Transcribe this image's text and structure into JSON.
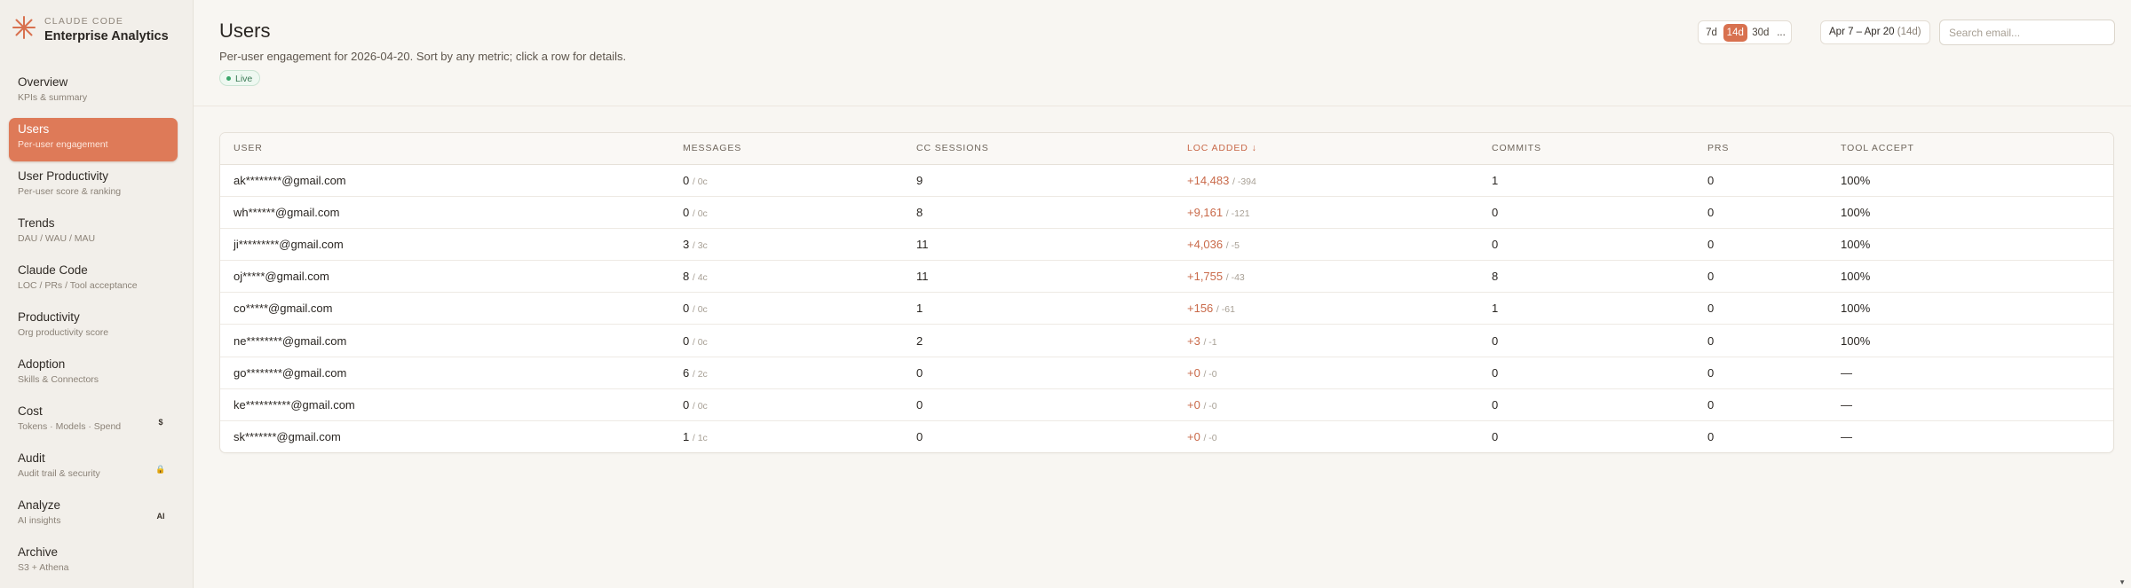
{
  "brand": {
    "sub": "CLAUDE CODE",
    "title": "Enterprise Analytics",
    "mark": "sparkle-icon"
  },
  "nav": [
    {
      "label": "Overview",
      "sub": "KPIs & summary"
    },
    {
      "label": "Users",
      "sub": "Per-user engagement",
      "active": true
    },
    {
      "label": "User Productivity",
      "sub": "Per-user score & ranking"
    },
    {
      "label": "Trends",
      "sub": "DAU / WAU / MAU"
    },
    {
      "label": "Claude Code",
      "sub": "LOC / PRs / Tool acceptance"
    },
    {
      "label": "Productivity",
      "sub": "Org productivity score"
    },
    {
      "label": "Adoption",
      "sub": "Skills & Connectors"
    },
    {
      "label": "Cost",
      "sub": "Tokens · Models · Spend",
      "badge": "$"
    },
    {
      "label": "Audit",
      "sub": "Audit trail & security",
      "badge": "🔒"
    },
    {
      "label": "Analyze",
      "sub": "AI insights",
      "badge": "AI"
    },
    {
      "label": "Archive",
      "sub": "S3 + Athena"
    }
  ],
  "header": {
    "title": "Users",
    "description": "Per-user engagement for 2026-04-20. Sort by any metric; click a row for details.",
    "live": "Live",
    "periods": [
      "7d",
      "14d",
      "30d",
      "..."
    ],
    "active_period": "14d",
    "range": "Apr 7 – Apr 20",
    "range_days": "(14d)",
    "search_placeholder": "Search email..."
  },
  "table": {
    "columns": [
      "USER",
      "MESSAGES",
      "CC SESSIONS",
      "LOC ADDED ↓",
      "COMMITS",
      "PRS",
      "TOOL ACCEPT"
    ],
    "sorted_column": 3,
    "rows": [
      {
        "user": "ak********@gmail.com",
        "msgs": "0",
        "msgs_sub": "/ 0c",
        "sessions": "9",
        "loc": "+14,483",
        "loc_sub": "/ -394",
        "commits": "1",
        "prs": "0",
        "accept": "100%"
      },
      {
        "user": "wh******@gmail.com",
        "msgs": "0",
        "msgs_sub": "/ 0c",
        "sessions": "8",
        "loc": "+9,161",
        "loc_sub": "/ -121",
        "commits": "0",
        "prs": "0",
        "accept": "100%"
      },
      {
        "user": "ji*********@gmail.com",
        "msgs": "3",
        "msgs_sub": "/ 3c",
        "sessions": "11",
        "loc": "+4,036",
        "loc_sub": "/ -5",
        "commits": "0",
        "prs": "0",
        "accept": "100%"
      },
      {
        "user": "oj*****@gmail.com",
        "msgs": "8",
        "msgs_sub": "/ 4c",
        "sessions": "11",
        "loc": "+1,755",
        "loc_sub": "/ -43",
        "commits": "8",
        "prs": "0",
        "accept": "100%"
      },
      {
        "user": "co*****@gmail.com",
        "msgs": "0",
        "msgs_sub": "/ 0c",
        "sessions": "1",
        "loc": "+156",
        "loc_sub": "/ -61",
        "commits": "1",
        "prs": "0",
        "accept": "100%"
      },
      {
        "user": "ne********@gmail.com",
        "msgs": "0",
        "msgs_sub": "/ 0c",
        "sessions": "2",
        "loc": "+3",
        "loc_sub": "/ -1",
        "commits": "0",
        "prs": "0",
        "accept": "100%"
      },
      {
        "user": "go********@gmail.com",
        "msgs": "6",
        "msgs_sub": "/ 2c",
        "sessions": "0",
        "loc": "+0",
        "loc_sub": "/ -0",
        "commits": "0",
        "prs": "0",
        "accept": "—"
      },
      {
        "user": "ke**********@gmail.com",
        "msgs": "0",
        "msgs_sub": "/ 0c",
        "sessions": "0",
        "loc": "+0",
        "loc_sub": "/ -0",
        "commits": "0",
        "prs": "0",
        "accept": "—"
      },
      {
        "user": "sk*******@gmail.com",
        "msgs": "1",
        "msgs_sub": "/ 1c",
        "sessions": "0",
        "loc": "+0",
        "loc_sub": "/ -0",
        "commits": "0",
        "prs": "0",
        "accept": "—"
      }
    ]
  },
  "colors": {
    "accent": "#de7a58",
    "live": "#3aa66a",
    "background": "#f8f6f2"
  }
}
